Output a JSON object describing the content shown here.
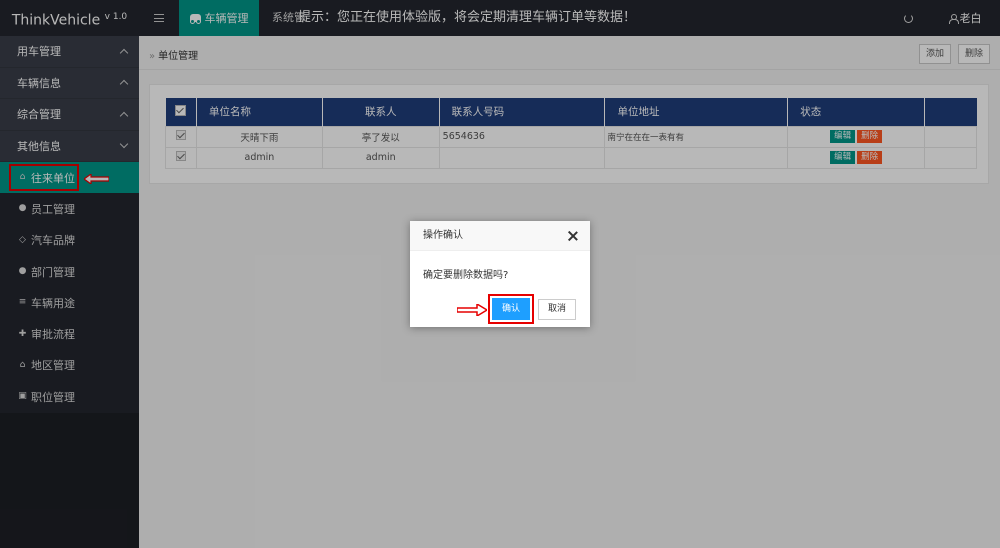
{
  "app": {
    "name": "ThinkVehicle",
    "version": "v 1.0"
  },
  "topbar": {
    "active_tab": "车辆管理",
    "second_item": "系统管",
    "notice": "提示：您正在使用体验版，将会定期清理车辆订单等数据！",
    "user": "老白",
    "icons": [
      "menu-icon",
      "car-icon",
      "refresh-icon",
      "user-icon"
    ]
  },
  "sidebar": {
    "groups": [
      {
        "label": "用车管理",
        "expanded": true
      },
      {
        "label": "车辆信息",
        "expanded": true
      },
      {
        "label": "综合管理",
        "expanded": true
      },
      {
        "label": "其他信息",
        "expanded": false
      }
    ],
    "items": [
      {
        "label": "往来单位",
        "icon": "bank-icon",
        "active": true
      },
      {
        "label": "员工管理",
        "icon": "person-icon"
      },
      {
        "label": "汽车品牌",
        "icon": "diamond-icon"
      },
      {
        "label": "部门管理",
        "icon": "group-icon"
      },
      {
        "label": "车辆用途",
        "icon": "list-icon"
      },
      {
        "label": "审批流程",
        "icon": "flow-icon"
      },
      {
        "label": "地区管理",
        "icon": "home-icon"
      },
      {
        "label": "职位管理",
        "icon": "camera-icon"
      }
    ]
  },
  "content": {
    "breadcrumb": "单位管理",
    "add_label": "添加",
    "delete_label": "删除",
    "table": {
      "headers": [
        "单位名称",
        "联系人",
        "联系人号码",
        "单位地址",
        "状态"
      ],
      "rows": [
        {
          "name": "天晴下雨",
          "contact": "亭了发以",
          "phone": "5654636",
          "address": "南宁在在在一表有有"
        },
        {
          "name": "admin",
          "contact": "admin",
          "phone": "",
          "address": ""
        }
      ],
      "edit_label": "编辑",
      "del_label": "删除"
    }
  },
  "dialog": {
    "title": "操作确认",
    "message": "确定要删除数据吗?",
    "ok_label": "确认",
    "cancel_label": "取消"
  },
  "colors": {
    "teal": "#009688",
    "dark": "#23262e",
    "header_blue": "#1f3d7a",
    "ok_blue": "#1e9fff",
    "danger": "#ff5722",
    "annotation_red": "#e60000"
  }
}
